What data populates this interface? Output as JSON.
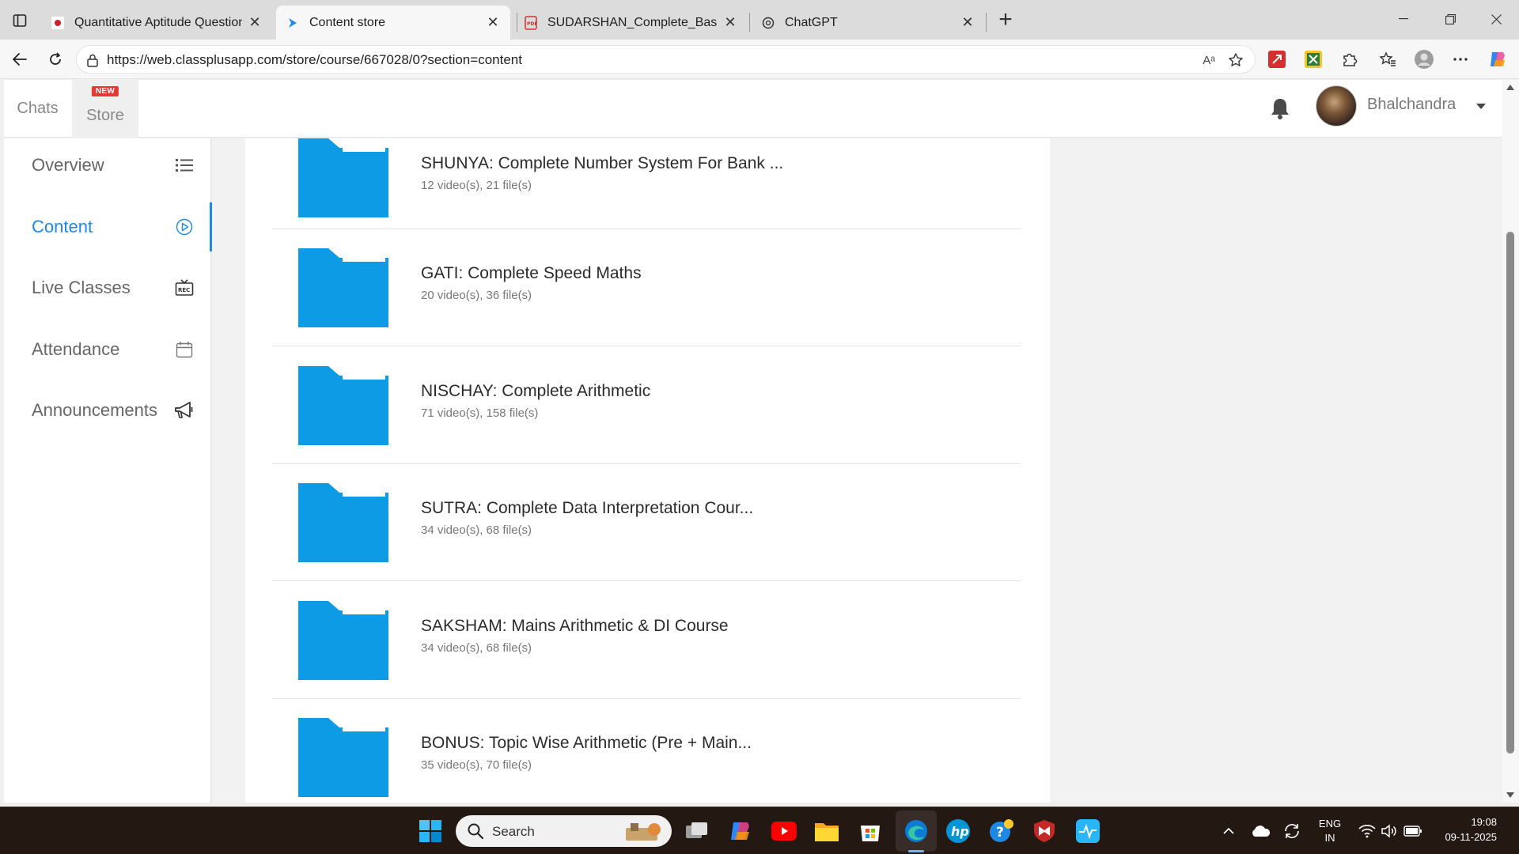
{
  "browser": {
    "tabs": [
      {
        "title": "Quantitative Aptitude Questions A",
        "active": false
      },
      {
        "title": "Content store",
        "active": true
      },
      {
        "title": "SUDARSHAN_Complete_Basic_to_A",
        "active": false
      },
      {
        "title": "ChatGPT",
        "active": false
      }
    ],
    "url": "https://web.classplusapp.com/store/course/667028/0?section=content",
    "read_aloud_label": "Aᵃ"
  },
  "header": {
    "tabs": [
      {
        "label": "Chats"
      },
      {
        "label": "Store",
        "badge": "NEW"
      }
    ],
    "username": "Bhalchandra"
  },
  "sidebar": {
    "items": [
      {
        "label": "Overview",
        "icon": "list-icon",
        "active": false
      },
      {
        "label": "Content",
        "icon": "play-circle-icon",
        "active": true
      },
      {
        "label": "Live Classes",
        "icon": "rec-icon",
        "active": false
      },
      {
        "label": "Attendance",
        "icon": "calendar-icon",
        "active": false
      },
      {
        "label": "Announcements",
        "icon": "megaphone-icon",
        "active": false
      }
    ]
  },
  "content": {
    "folders": [
      {
        "name": "SHUNYA: Complete Number System For Bank ...",
        "meta": "12 video(s), 21 file(s)"
      },
      {
        "name": "GATI: Complete Speed Maths",
        "meta": "20 video(s), 36 file(s)"
      },
      {
        "name": "NISCHAY: Complete Arithmetic",
        "meta": "71 video(s), 158 file(s)"
      },
      {
        "name": "SUTRA: Complete Data Interpretation Cour...",
        "meta": "34 video(s), 68 file(s)"
      },
      {
        "name": "SAKSHAM: Mains Arithmetic & DI Course",
        "meta": "34 video(s), 68 file(s)"
      },
      {
        "name": "BONUS: Topic Wise Arithmetic (Pre + Main...",
        "meta": "35 video(s), 70 file(s)"
      }
    ]
  },
  "taskbar": {
    "search_placeholder": "Search",
    "lang_line1": "ENG",
    "lang_line2": "IN",
    "time": "19:08",
    "date": "09-11-2025"
  },
  "colors": {
    "accent": "#1e88e5",
    "folder": "#0c9be4",
    "badge": "#e53935"
  }
}
